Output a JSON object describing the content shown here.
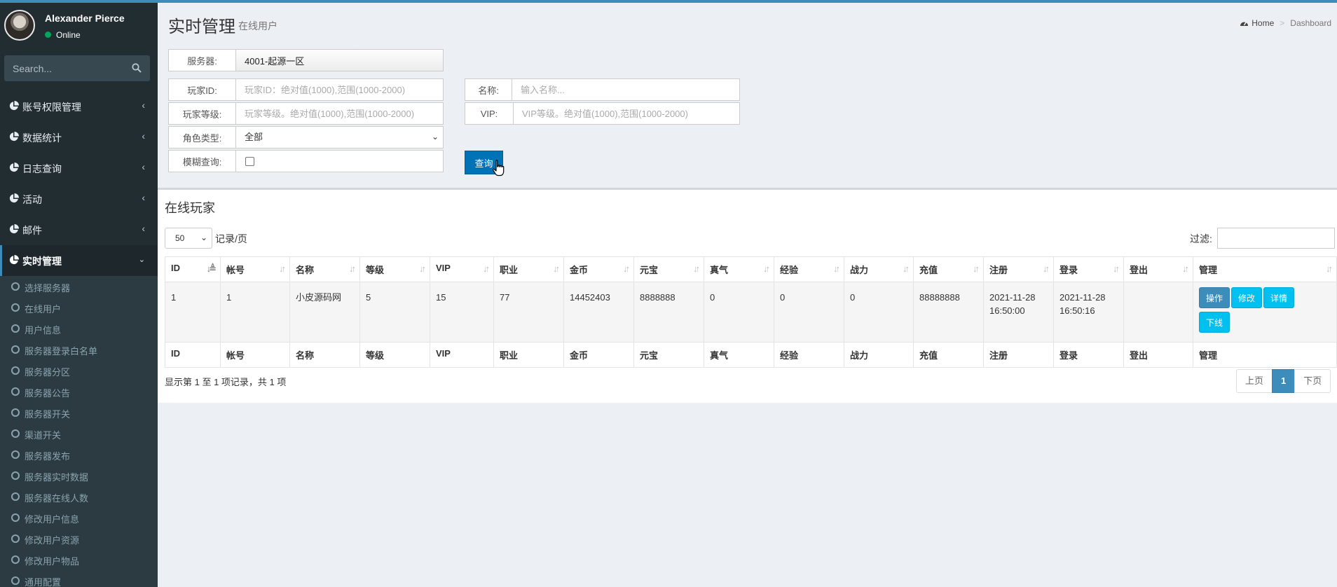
{
  "user": {
    "name": "Alexander Pierce",
    "status": "Online"
  },
  "sidebar": {
    "search_placeholder": "Search...",
    "menu": [
      {
        "label": "账号权限管理"
      },
      {
        "label": "数据统计"
      },
      {
        "label": "日志查询"
      },
      {
        "label": "活动"
      },
      {
        "label": "邮件"
      },
      {
        "label": "实时管理"
      }
    ],
    "submenu": [
      {
        "label": "选择服务器"
      },
      {
        "label": "在线用户"
      },
      {
        "label": "用户信息"
      },
      {
        "label": "服务器登录白名单"
      },
      {
        "label": "服务器分区"
      },
      {
        "label": "服务器公告"
      },
      {
        "label": "服务器开关"
      },
      {
        "label": "渠道开关"
      },
      {
        "label": "服务器发布"
      },
      {
        "label": "服务器实时数据"
      },
      {
        "label": "服务器在线人数"
      },
      {
        "label": "修改用户信息"
      },
      {
        "label": "修改用户资源"
      },
      {
        "label": "修改用户物品"
      },
      {
        "label": "通用配置"
      }
    ]
  },
  "header": {
    "title": "实时管理",
    "subtitle": "在线用户",
    "breadcrumb_home": "Home",
    "breadcrumb_current": "Dashboard"
  },
  "form": {
    "server_label": "服务器:",
    "server_value": "4001-起源一区",
    "player_id_label": "玩家ID:",
    "player_id_placeholder": "玩家ID：绝对值(1000),范围(1000-2000)",
    "player_level_label": "玩家等级:",
    "player_level_placeholder": "玩家等级。绝对值(1000),范围(1000-2000)",
    "role_type_label": "角色类型:",
    "role_type_value": "全部",
    "fuzzy_label": "模糊查询:",
    "name_label": "名称:",
    "name_placeholder": "输入名称...",
    "vip_label": "VIP:",
    "vip_placeholder": "VIP等级。绝对值(1000),范围(1000-2000)",
    "query_button": "查询"
  },
  "box": {
    "title": "在线玩家",
    "page_length": "50",
    "page_length_suffix": "记录/页",
    "filter_label": "过滤:",
    "columns": [
      "ID",
      "帐号",
      "名称",
      "等级",
      "VIP",
      "职业",
      "金币",
      "元宝",
      "真气",
      "经验",
      "战力",
      "充值",
      "注册",
      "登录",
      "登出",
      "管理"
    ],
    "rows": [
      {
        "id": "1",
        "account": "1",
        "name": "小皮源码网",
        "level": "5",
        "vip": "15",
        "job": "77",
        "gold": "14452403",
        "yuanbao": "8888888",
        "zhenqi": "0",
        "exp": "0",
        "power": "0",
        "recharge": "88888888",
        "register": "2021-11-28 16:50:00",
        "login": "2021-11-28 16:50:16",
        "logout": "",
        "actions": {
          "operate": "操作",
          "edit": "修改",
          "detail": "详情",
          "kick": "下线"
        }
      }
    ],
    "info": "显示第 1 至 1 项记录，共 1 项",
    "pagination": {
      "prev": "上页",
      "page": "1",
      "next": "下页"
    }
  },
  "colors": {
    "accent": "#3c8dbc",
    "sidebar_bg": "#222d32",
    "query_button": "#0073b7",
    "info_button": "#00c0ef"
  }
}
